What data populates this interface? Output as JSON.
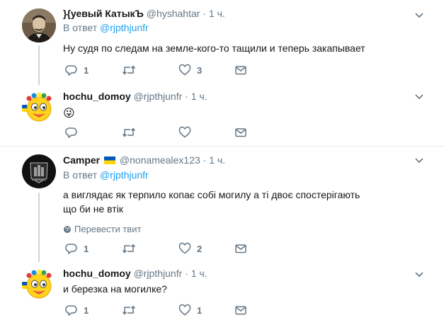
{
  "tweets": [
    {
      "name": "}{уевый КатыкЪ",
      "handle": "@hyshahtar",
      "dot": "·",
      "time": "1 ч.",
      "reply_prefix": "В ответ",
      "reply_to": "@rjpthjunfr",
      "text": "Ну судя по следам на земле-кого-то тащили и теперь закапывает",
      "replies": "1",
      "retweets": "",
      "likes": "3"
    },
    {
      "name": "hochu_domoy",
      "handle": "@rjpthjunfr",
      "dot": "·",
      "time": "1 ч.",
      "text": "😜",
      "replies": "",
      "retweets": "",
      "likes": ""
    },
    {
      "name": "Camper",
      "flag": "🇺🇦",
      "handle": "@nonamealex123",
      "dot": "·",
      "time": "1 ч.",
      "reply_prefix": "В ответ",
      "reply_to": "@rjpthjunfr",
      "text": "а виглядає як терпило копає собі могилу а ті двоє спостерігають що би не втік",
      "translate": "Перевести твит",
      "replies": "1",
      "retweets": "",
      "likes": "2"
    },
    {
      "name": "hochu_domoy",
      "handle": "@rjpthjunfr",
      "dot": "·",
      "time": "1 ч.",
      "text": "и березка на могилке?",
      "replies": "1",
      "retweets": "",
      "likes": "1"
    }
  ],
  "icons": {
    "reply": "reply-icon",
    "retweet": "retweet-icon",
    "like": "heart-icon",
    "dm": "envelope-icon",
    "more": "chevron-down-icon",
    "translate": "globe-icon"
  },
  "colors": {
    "link": "#1da1f2",
    "muted": "#657786",
    "text": "#14171a",
    "divider": "#e6ecf0"
  }
}
